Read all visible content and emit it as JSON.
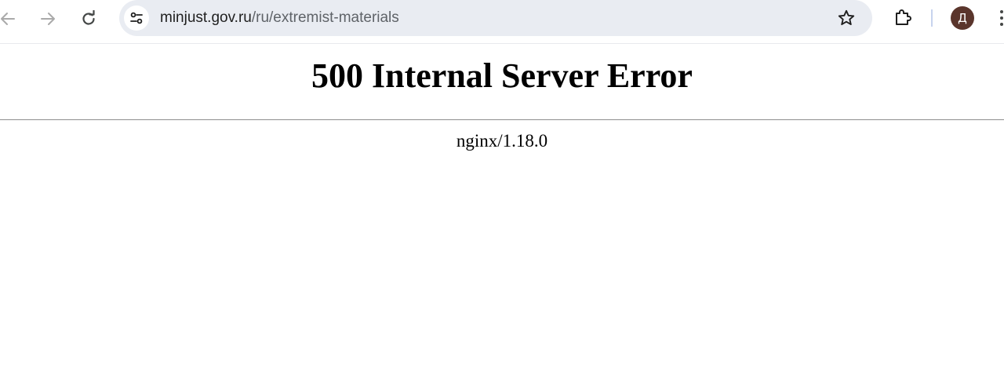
{
  "browser": {
    "url_host": "minjust.gov.ru",
    "url_path": "/ru/extremist-materials",
    "profile_initial": "Д",
    "icons": {
      "back": "arrow-left-icon",
      "forward": "arrow-right-icon",
      "reload": "reload-icon",
      "site_info": "tune-icon",
      "bookmark": "star-icon",
      "extensions": "puzzle-icon",
      "menu": "kebab-menu-icon"
    },
    "colors": {
      "omnibox_bg": "#e9ecf2",
      "avatar_bg": "#5a352c"
    }
  },
  "page": {
    "heading": "500 Internal Server Error",
    "server": "nginx/1.18.0"
  }
}
